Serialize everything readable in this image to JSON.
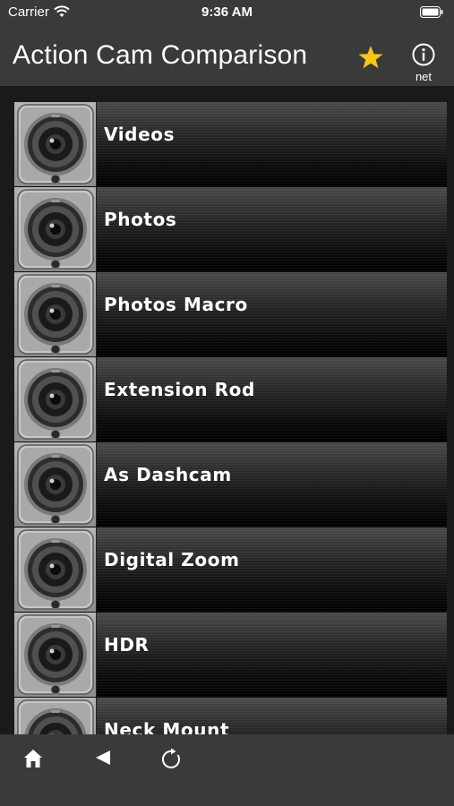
{
  "status_bar": {
    "carrier": "Carrier",
    "time": "9:36 AM",
    "wifi_icon": "wifi-icon",
    "battery_icon": "battery-icon"
  },
  "nav": {
    "title": "Action Cam Comparison",
    "favorite_icon": "star-icon",
    "favorite_color": "#F5C518",
    "info_icon": "info-circle-icon",
    "info_caption": "net"
  },
  "list": {
    "items": [
      {
        "label": "Videos"
      },
      {
        "label": "Photos"
      },
      {
        "label": "Photos Macro"
      },
      {
        "label": "Extension Rod"
      },
      {
        "label": "As Dashcam"
      },
      {
        "label": "Digital Zoom"
      },
      {
        "label": "HDR"
      },
      {
        "label": "Neck Mount"
      }
    ],
    "thumbnail_icon": "action-camera-icon"
  },
  "tab_bar": {
    "home_icon": "home-icon",
    "back_icon": "back-triangle-icon",
    "reload_icon": "reload-icon"
  },
  "colors": {
    "bar_background": "#3A3A3A",
    "list_background": "#1A1A1A",
    "text": "#FFFFFF"
  }
}
